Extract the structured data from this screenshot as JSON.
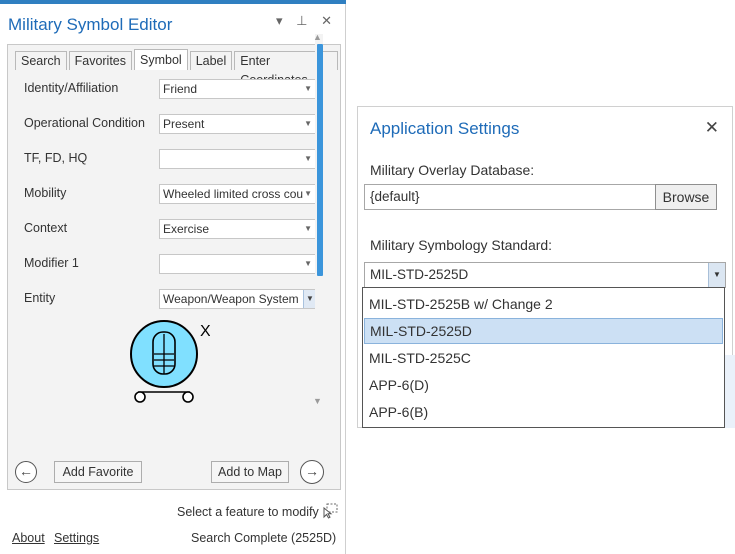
{
  "panel": {
    "title": "Military Symbol Editor",
    "controls": {
      "menu": "▾",
      "pin": "⊥",
      "close": "✕"
    },
    "tabs": [
      {
        "label": "Search"
      },
      {
        "label": "Favorites"
      },
      {
        "label": "Symbol"
      },
      {
        "label": "Label"
      },
      {
        "label": "Enter Coordinates"
      }
    ],
    "active_tab": "Symbol",
    "fields": [
      {
        "label": "Identity/Affiliation",
        "value": "Friend"
      },
      {
        "label": "Operational Condition",
        "value": "Present"
      },
      {
        "label": "TF, FD, HQ",
        "value": ""
      },
      {
        "label": "Mobility",
        "value": "Wheeled limited cross cou"
      },
      {
        "label": "Context",
        "value": "Exercise"
      },
      {
        "label": "Modifier 1",
        "value": ""
      },
      {
        "label": "Entity",
        "value": "Weapon/Weapon System :"
      }
    ],
    "symbol_modifier_text": "X",
    "buttons": {
      "back": "←",
      "add_favorite": "Add Favorite",
      "add_to_map": "Add to Map",
      "forward": "→"
    },
    "status": {
      "select_feature": "Select a feature to modify",
      "about": "About",
      "settings": "Settings",
      "search_status": "Search Complete (2525D)"
    },
    "colors": {
      "accent": "#1e6bb8",
      "symbol_fill": "#80e0ff",
      "scroll": "#3b95db"
    }
  },
  "dialog": {
    "title": "Application Settings",
    "close": "✕",
    "overlay_db_label": "Military Overlay Database:",
    "overlay_db_value": "{default}",
    "browse_label": "Browse",
    "standard_label": "Military Symbology Standard:",
    "standard_value": "MIL-STD-2525D",
    "options": [
      "MIL-STD-2525B w/ Change 2",
      "MIL-STD-2525D",
      "MIL-STD-2525C",
      "APP-6(D)",
      "APP-6(B)"
    ],
    "selected_option": "MIL-STD-2525D"
  }
}
